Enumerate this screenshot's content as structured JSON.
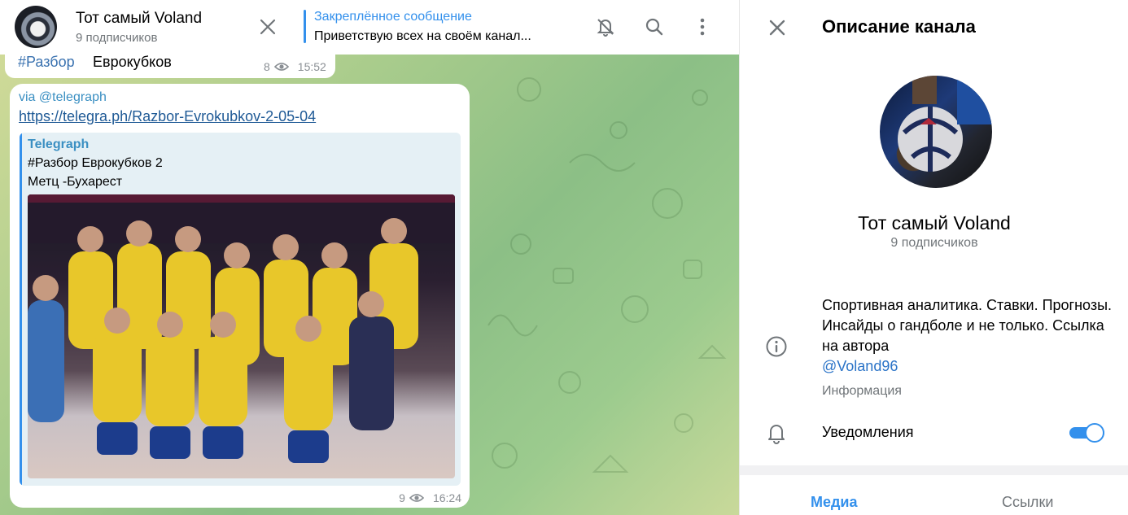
{
  "header": {
    "title": "Тот самый Voland",
    "subscribers": "9 подписчиков",
    "pinned_label": "Закреплённое сообщение",
    "pinned_text": "Приветствую всех на своём канал..."
  },
  "messages": {
    "prev": {
      "hashtag": "#Разбор",
      "text": "Еврокубков",
      "views": "8",
      "time": "15:52"
    },
    "main": {
      "via": "via @telegraph",
      "link": "https://telegra.ph/Razbor-Evrokubkov-2-05-04",
      "preview": {
        "site": "Telegraph",
        "title": "#Разбор Еврокубков 2",
        "description": "Метц -Бухарест"
      },
      "views": "9",
      "time": "16:24"
    }
  },
  "panel": {
    "title": "Описание канала",
    "name": "Тот самый Voland",
    "subscribers": "9 подписчиков",
    "description": "Спортивная аналитика. Ставки. Прогнозы. Инсайды о гандболе и не только. Ссылка на автора",
    "description_link": "@Voland96",
    "info_label": "Информация",
    "notifications_label": "Уведомления",
    "notifications_on": true,
    "tabs": [
      "Медиа",
      "Ссылки"
    ]
  },
  "colors": {
    "accent": "#3390ec",
    "secondary_text": "#707579"
  }
}
